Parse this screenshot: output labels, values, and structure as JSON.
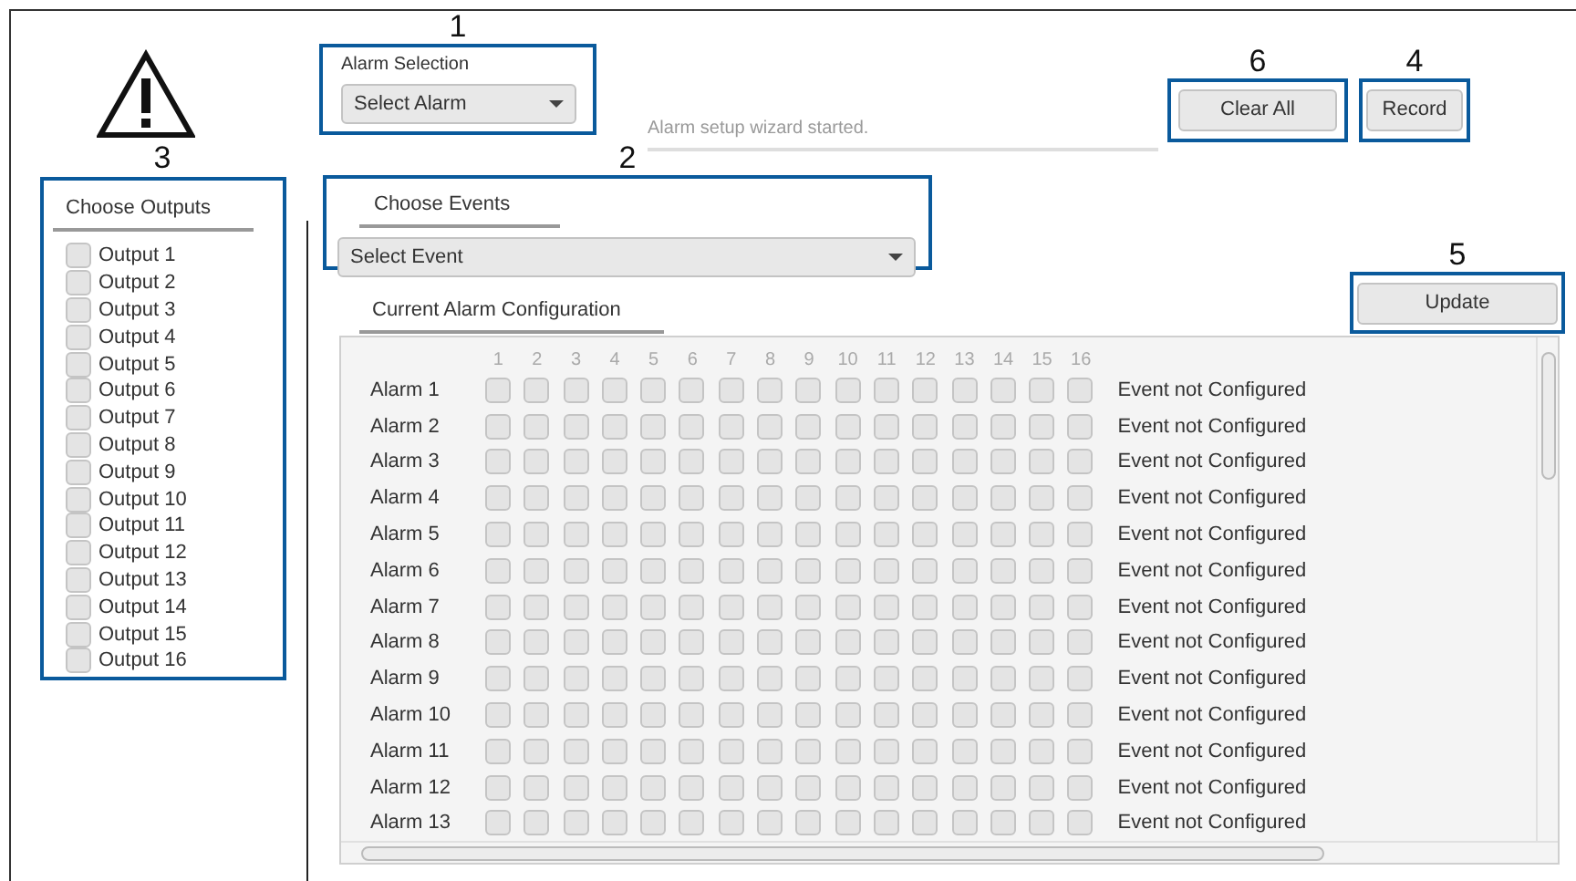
{
  "alarm_selection": {
    "callout": "1",
    "label": "Alarm Selection",
    "dropdown": "Select Alarm"
  },
  "status_message": "Alarm setup wizard started.",
  "clear_all": {
    "callout": "6",
    "label": "Clear All"
  },
  "record": {
    "callout": "4",
    "label": "Record"
  },
  "outputs_panel": {
    "callout": "3",
    "title": "Choose Outputs",
    "outputs": [
      {
        "label": "Output 1",
        "checked": false
      },
      {
        "label": "Output 2",
        "checked": false
      },
      {
        "label": "Output 3",
        "checked": false
      },
      {
        "label": "Output 4",
        "checked": false
      },
      {
        "label": "Output 5",
        "checked": false
      },
      {
        "label": "Output 6",
        "checked": false
      },
      {
        "label": "Output 7",
        "checked": false
      },
      {
        "label": "Output 8",
        "checked": false
      },
      {
        "label": "Output 9",
        "checked": false
      },
      {
        "label": "Output 10",
        "checked": false
      },
      {
        "label": "Output 11",
        "checked": false
      },
      {
        "label": "Output 12",
        "checked": false
      },
      {
        "label": "Output 13",
        "checked": false
      },
      {
        "label": "Output 14",
        "checked": false
      },
      {
        "label": "Output 15",
        "checked": false
      },
      {
        "label": "Output 16",
        "checked": false
      }
    ]
  },
  "events_panel": {
    "callout": "2",
    "title": "Choose Events",
    "dropdown": "Select Event"
  },
  "update": {
    "callout": "5",
    "label": "Update"
  },
  "configuration": {
    "title": "Current Alarm Configuration",
    "columns": [
      "1",
      "2",
      "3",
      "4",
      "5",
      "6",
      "7",
      "8",
      "9",
      "10",
      "11",
      "12",
      "13",
      "14",
      "15",
      "16"
    ],
    "alarms": [
      {
        "name": "Alarm 1",
        "outputs": [
          false,
          false,
          false,
          false,
          false,
          false,
          false,
          false,
          false,
          false,
          false,
          false,
          false,
          false,
          false,
          false
        ],
        "event": "Event not Configured"
      },
      {
        "name": "Alarm 2",
        "outputs": [
          false,
          false,
          false,
          false,
          false,
          false,
          false,
          false,
          false,
          false,
          false,
          false,
          false,
          false,
          false,
          false
        ],
        "event": "Event not Configured"
      },
      {
        "name": "Alarm 3",
        "outputs": [
          false,
          false,
          false,
          false,
          false,
          false,
          false,
          false,
          false,
          false,
          false,
          false,
          false,
          false,
          false,
          false
        ],
        "event": "Event not Configured"
      },
      {
        "name": "Alarm 4",
        "outputs": [
          false,
          false,
          false,
          false,
          false,
          false,
          false,
          false,
          false,
          false,
          false,
          false,
          false,
          false,
          false,
          false
        ],
        "event": "Event not Configured"
      },
      {
        "name": "Alarm 5",
        "outputs": [
          false,
          false,
          false,
          false,
          false,
          false,
          false,
          false,
          false,
          false,
          false,
          false,
          false,
          false,
          false,
          false
        ],
        "event": "Event not Configured"
      },
      {
        "name": "Alarm 6",
        "outputs": [
          false,
          false,
          false,
          false,
          false,
          false,
          false,
          false,
          false,
          false,
          false,
          false,
          false,
          false,
          false,
          false
        ],
        "event": "Event not Configured"
      },
      {
        "name": "Alarm 7",
        "outputs": [
          false,
          false,
          false,
          false,
          false,
          false,
          false,
          false,
          false,
          false,
          false,
          false,
          false,
          false,
          false,
          false
        ],
        "event": "Event not Configured"
      },
      {
        "name": "Alarm 8",
        "outputs": [
          false,
          false,
          false,
          false,
          false,
          false,
          false,
          false,
          false,
          false,
          false,
          false,
          false,
          false,
          false,
          false
        ],
        "event": "Event not Configured"
      },
      {
        "name": "Alarm 9",
        "outputs": [
          false,
          false,
          false,
          false,
          false,
          false,
          false,
          false,
          false,
          false,
          false,
          false,
          false,
          false,
          false,
          false
        ],
        "event": "Event not Configured"
      },
      {
        "name": "Alarm 10",
        "outputs": [
          false,
          false,
          false,
          false,
          false,
          false,
          false,
          false,
          false,
          false,
          false,
          false,
          false,
          false,
          false,
          false
        ],
        "event": "Event not Configured"
      },
      {
        "name": "Alarm 11",
        "outputs": [
          false,
          false,
          false,
          false,
          false,
          false,
          false,
          false,
          false,
          false,
          false,
          false,
          false,
          false,
          false,
          false
        ],
        "event": "Event not Configured"
      },
      {
        "name": "Alarm 12",
        "outputs": [
          false,
          false,
          false,
          false,
          false,
          false,
          false,
          false,
          false,
          false,
          false,
          false,
          false,
          false,
          false,
          false
        ],
        "event": "Event not Configured"
      },
      {
        "name": "Alarm 13",
        "outputs": [
          false,
          false,
          false,
          false,
          false,
          false,
          false,
          false,
          false,
          false,
          false,
          false,
          false,
          false,
          false,
          false
        ],
        "event": "Event not Configured"
      }
    ]
  }
}
